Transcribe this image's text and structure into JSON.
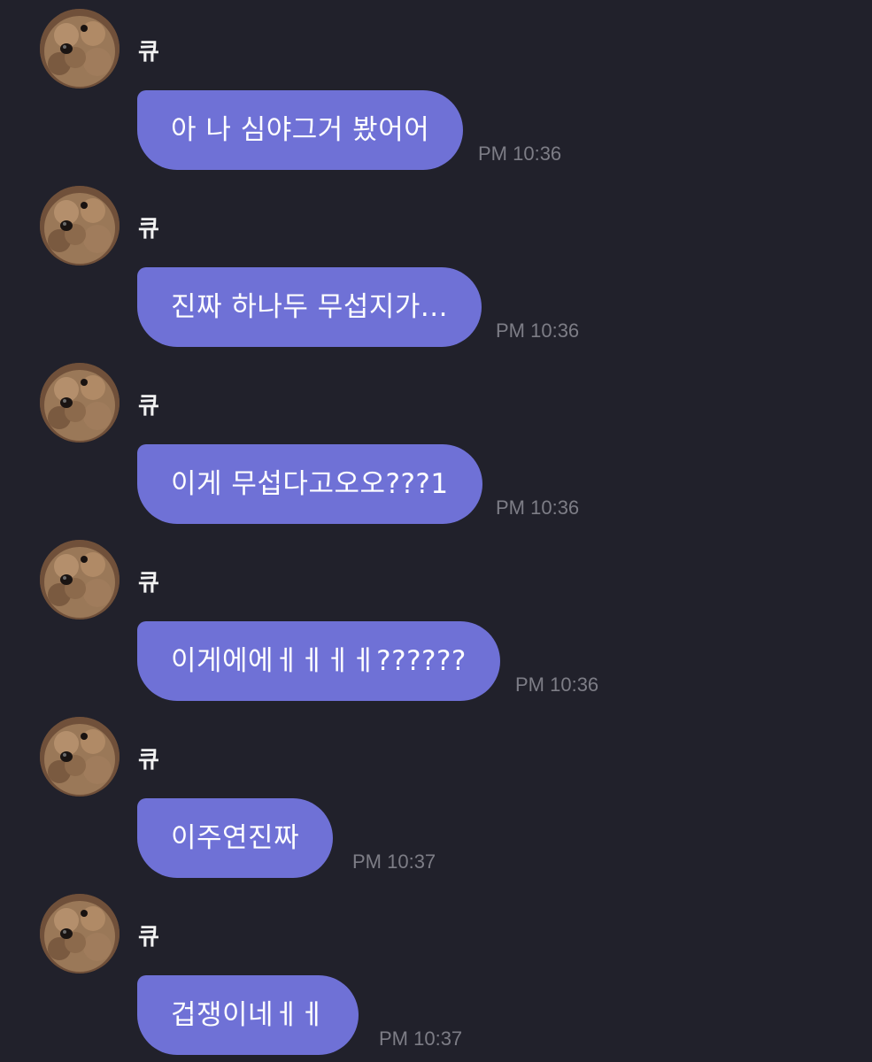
{
  "messages": [
    {
      "sender": "큐",
      "text": "아 나 심야그거 봤어어",
      "time": "PM 10:36"
    },
    {
      "sender": "큐",
      "text": "진짜 하나두 무섭지가...",
      "time": "PM 10:36"
    },
    {
      "sender": "큐",
      "text": "이게 무섭다고오오???1",
      "time": "PM 10:36"
    },
    {
      "sender": "큐",
      "text": "이게에에ㅔㅔㅔㅔ??????",
      "time": "PM 10:36"
    },
    {
      "sender": "큐",
      "text": "이주연진짜",
      "time": "PM 10:37"
    },
    {
      "sender": "큐",
      "text": "겁쟁이네ㅔㅔ",
      "time": "PM 10:37"
    }
  ],
  "colors": {
    "background": "#21212b",
    "bubble": "#6f71d6",
    "timestamp": "#7d7d86",
    "sender": "#f2f2f2"
  },
  "avatar_icon": "poodle-avatar-icon"
}
